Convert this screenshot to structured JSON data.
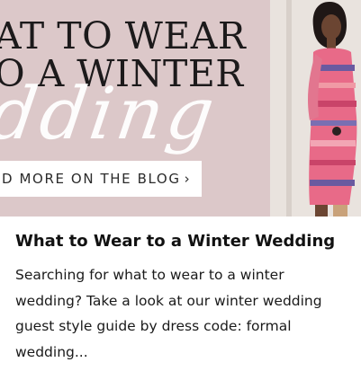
{
  "hero": {
    "headline_line1": "AT TO WEAR",
    "headline_line2": "O A WINTER",
    "headline_script": "dding",
    "cta_label": "D MORE ON THE BLOG",
    "cta_icon": "chevron-right-icon",
    "background_color": "#dcc8c9"
  },
  "post": {
    "title": "What to Wear to a Winter Wedding",
    "excerpt": "Searching for what to wear to a winter wedding? Take a look at our winter wedding guest style guide by dress code: formal wedding..."
  }
}
